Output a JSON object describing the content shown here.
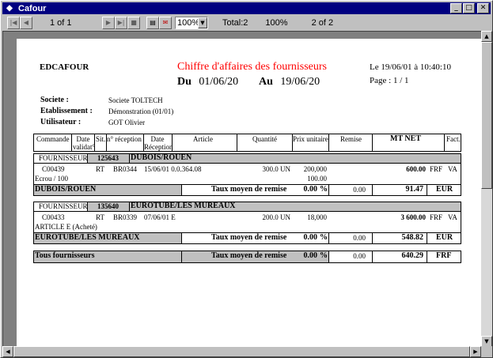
{
  "window": {
    "title": "Cafour"
  },
  "toolbar": {
    "page_of": "1 of 1",
    "zoom_value": "100%",
    "total": "Total:2",
    "percent": "100%",
    "count_of": "2 of 2"
  },
  "report": {
    "company": "EDCAFOUR",
    "title": "Chiffre d'affaires des fournisseurs",
    "du_label": "Du",
    "du_value": "01/06/20",
    "au_label": "Au",
    "au_value": "19/06/20",
    "date_printed": "Le 19/06/01 à 10:40:10",
    "page_label": "Page : 1 / 1",
    "societe_label": "Societe :",
    "societe_value": "Societe TOLTECH",
    "etab_label": "Etablissement :",
    "etab_value": "Démonstration (01/01)",
    "user_label": "Utilisateur :",
    "user_value": "GOT Olivier"
  },
  "headers": {
    "commande": "Commande",
    "date_validat": "Date validat°",
    "sit": "Sit.",
    "reception": "n° réception",
    "date_reception": "Date Réception",
    "article": "Article",
    "quantite": "Quantité",
    "prix": "Prix unitaire",
    "remise": "Remise",
    "mtnet": "MT NET",
    "fact": "Fact."
  },
  "groups": [
    {
      "fournisseur_label": "FOURNISSEUR",
      "code": "125643",
      "name": "DUBOIS/ROUEN",
      "line": {
        "commande": "C00439",
        "sit": "RT",
        "reception": "BR0344",
        "date_article": "15/06/01 0.0.364.08",
        "quantite": "300.0 UN",
        "prix": "200,000",
        "prix2": "100.00",
        "mtnet": "600.00",
        "devise": "FRF",
        "fact": "VA",
        "desc": "Ecrou / 100"
      },
      "total": {
        "name": "DUBOIS/ROUEN",
        "taux_label": "Taux moyen de remise",
        "taux": "0.00",
        "pct": "%",
        "remise": "0.00",
        "mtnet": "91.47",
        "devise": "EUR"
      }
    },
    {
      "fournisseur_label": "FOURNISSEUR",
      "code": "135640",
      "name": "EUROTUBE/LES MUREAUX",
      "line": {
        "commande": "C00433",
        "sit": "RT",
        "reception": "BR0339",
        "date_article": "07/06/01 E",
        "quantite": "200.0 UN",
        "prix": "18,000",
        "prix2": "",
        "mtnet": "3 600.00",
        "devise": "FRF",
        "fact": "VA",
        "desc": "ARTICLE E (Acheté)"
      },
      "total": {
        "name": "EUROTUBE/LES MUREAUX",
        "taux_label": "Taux moyen de remise",
        "taux": "0.00",
        "pct": "%",
        "remise": "0.00",
        "mtnet": "548.82",
        "devise": "EUR"
      }
    }
  ],
  "grand_total": {
    "name": "Tous fournisseurs",
    "taux_label": "Taux moyen de remise",
    "taux": "0.00",
    "pct": "%",
    "remise": "0.00",
    "mtnet": "640.29",
    "devise": "FRF"
  },
  "icons": {
    "first": "first-page-icon",
    "prev": "prev-page-icon",
    "next": "next-page-icon",
    "last": "last-page-icon",
    "stop": "stop-icon",
    "print": "print-icon",
    "export": "export-icon"
  }
}
